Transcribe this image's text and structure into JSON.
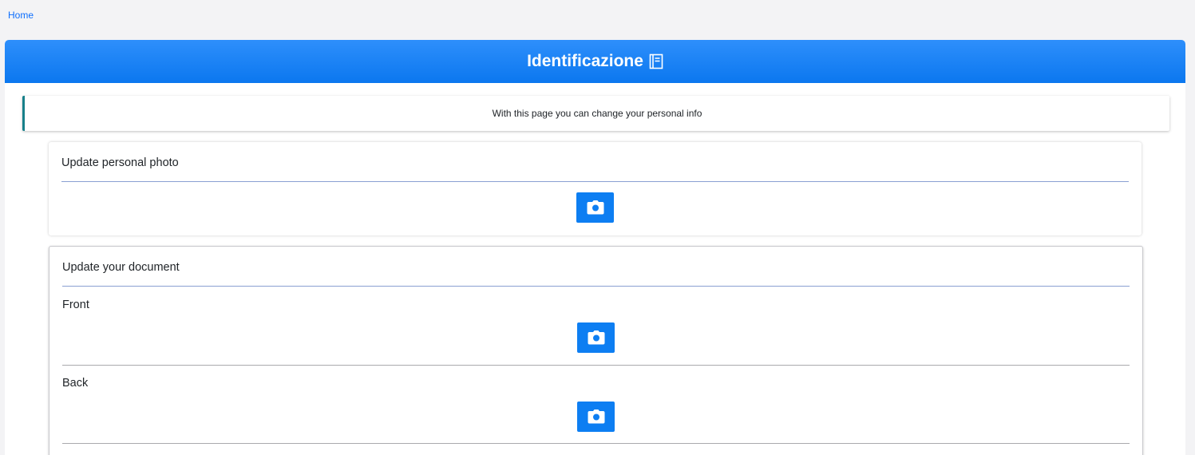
{
  "breadcrumb": {
    "home": "Home"
  },
  "header": {
    "title": "Identificazione",
    "icon": "book-icon"
  },
  "info": {
    "text": "With this page you can change your personal info"
  },
  "photo_section": {
    "title": "Update personal photo",
    "button_icon": "camera-icon"
  },
  "document_section": {
    "title": "Update your document",
    "front_label": "Front",
    "back_label": "Back",
    "button_icon": "camera-icon"
  },
  "colors": {
    "primary": "#0d7ef2",
    "header": "#1f86f7",
    "info_accent": "#17808a"
  }
}
